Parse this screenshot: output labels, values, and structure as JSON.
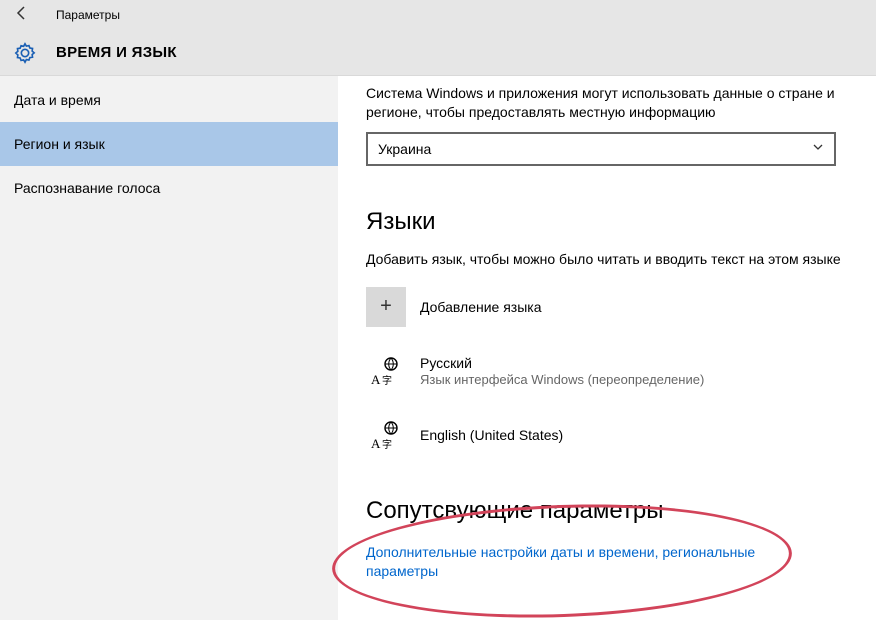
{
  "window": {
    "title": "Параметры"
  },
  "header": {
    "page_title": "ВРЕМЯ И ЯЗЫК"
  },
  "sidebar": {
    "items": [
      {
        "label": "Дата и время",
        "selected": false
      },
      {
        "label": "Регион и язык",
        "selected": true
      },
      {
        "label": "Распознавание голоса",
        "selected": false
      }
    ]
  },
  "main": {
    "region_desc": "Система Windows и приложения могут использовать данные о стране и регионе, чтобы предоставлять местную информацию",
    "region_dropdown": "Украина",
    "languages_heading": "Языки",
    "languages_desc": "Добавить язык, чтобы можно было читать и вводить текст на этом языке",
    "add_language_label": "Добавление языка",
    "languages": [
      {
        "name": "Русский",
        "sub": "Язык интерфейса Windows (переопределение)"
      },
      {
        "name": "English (United States)",
        "sub": ""
      }
    ],
    "related_heading": "Сопутсвующие параметры",
    "related_link": "Дополнительные настройки даты и времени, региональные параметры"
  }
}
